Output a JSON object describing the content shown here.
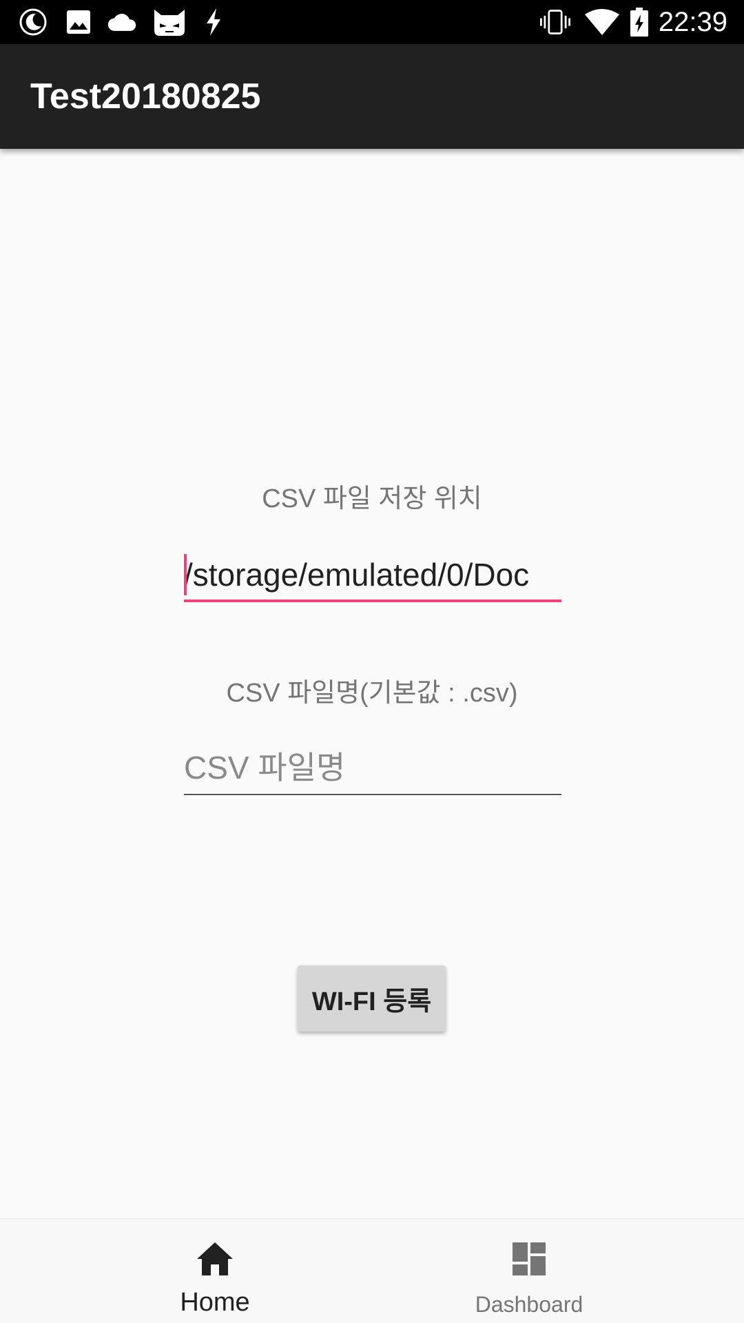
{
  "status_bar": {
    "time": "22:39",
    "left_icons": [
      "night-mode-icon",
      "image-icon",
      "cloud-icon",
      "cat-face-icon",
      "charging-bolt-icon"
    ],
    "right_icons": [
      "vibrate-icon",
      "wifi-icon",
      "battery-charging-icon"
    ]
  },
  "toolbar": {
    "title": "Test20180825"
  },
  "form": {
    "csv_location_label": "CSV 파일 저장 위치",
    "csv_location_value": "/storage/emulated/0/Doc",
    "csv_filename_label": "CSV 파일명(기본값 : .csv)",
    "csv_filename_value": "",
    "csv_filename_placeholder": "CSV 파일명",
    "wifi_button_label": "WI-FI 등록"
  },
  "colors": {
    "accent": "#e8457c",
    "toolbar": "#212121",
    "button": "#d6d6d6"
  },
  "bottom_nav": {
    "items": [
      {
        "label": "Home",
        "icon": "home-icon",
        "active": true
      },
      {
        "label": "Dashboard",
        "icon": "dashboard-icon",
        "active": false
      }
    ]
  }
}
